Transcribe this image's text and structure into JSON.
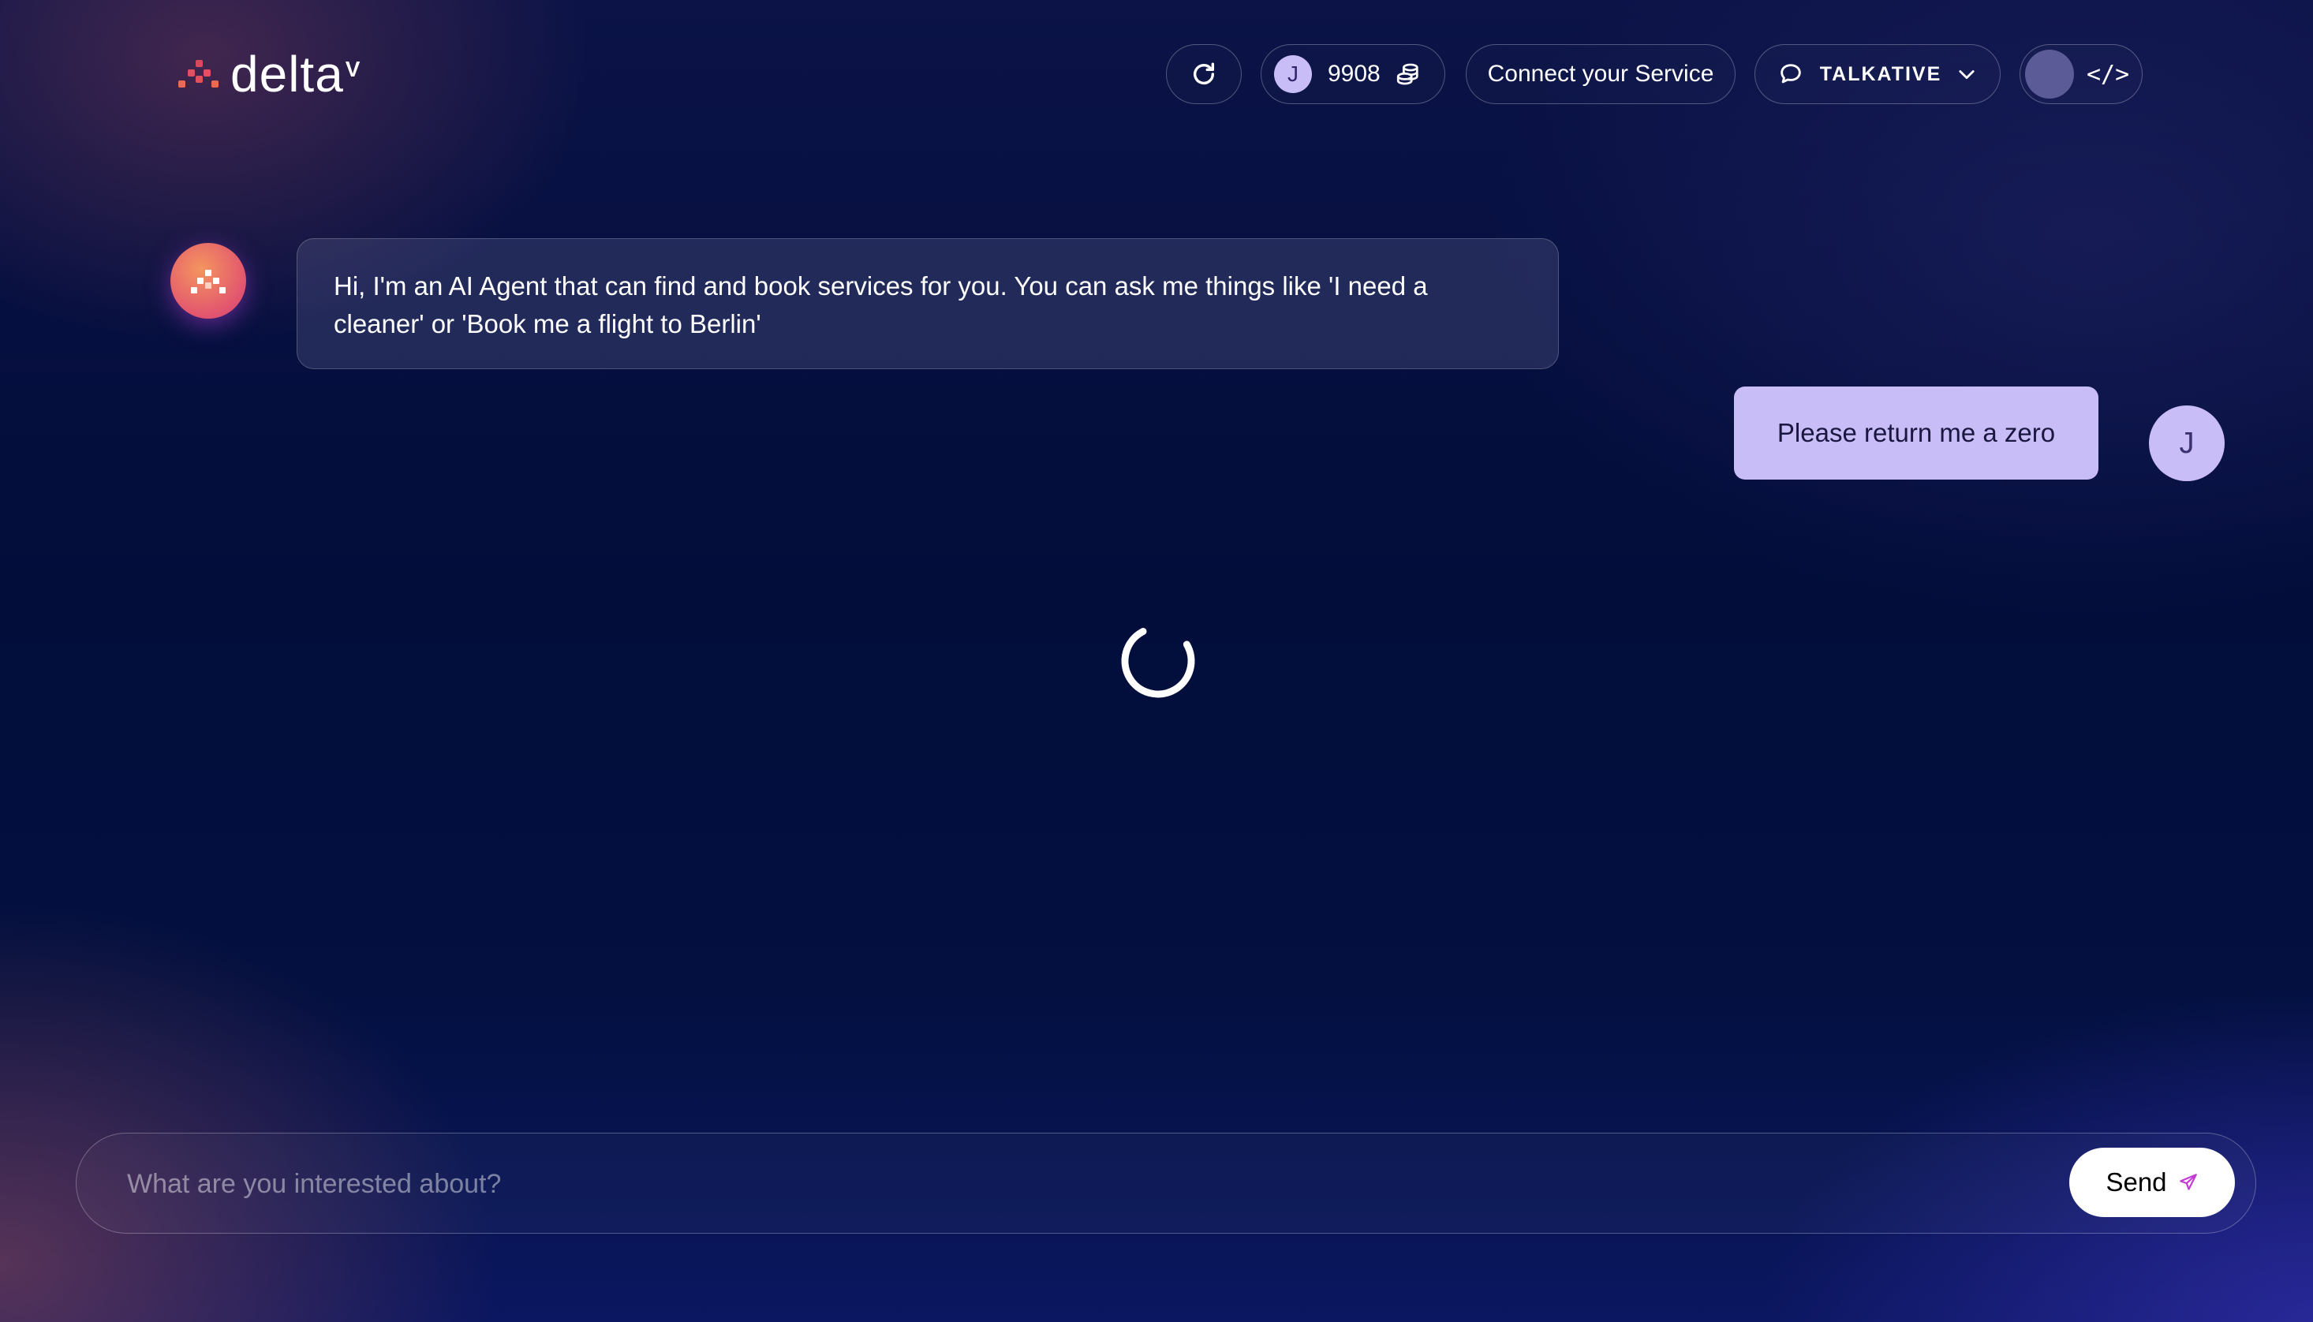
{
  "brand": {
    "name": "delta",
    "superscript": "V",
    "logo_icon": "delta-dots-logo"
  },
  "header": {
    "refresh_icon": "refresh-icon",
    "user_initial": "J",
    "credits": "9908",
    "credits_icon": "coins-icon",
    "connect_label": "Connect your Service",
    "mode_icon": "chat-bubble-icon",
    "mode_label": "TALKATIVE",
    "mode_chevron": "chevron-down-icon",
    "dev_icon": "code-icon",
    "dev_label": "</>"
  },
  "messages": [
    {
      "role": "agent",
      "text": "Hi, I'm an AI Agent that can find and book services for you. You can ask me things like 'I need a cleaner' or 'Book me a flight to Berlin'"
    },
    {
      "role": "user",
      "text": "Please return me a zero",
      "avatar": "J"
    }
  ],
  "composer": {
    "placeholder": "What are you interested about?",
    "value": "",
    "send_label": "Send",
    "send_icon": "paper-plane-icon"
  },
  "colors": {
    "accent": "#c9bdf7",
    "background": "#020d3a",
    "brand_dot": "#e0505e"
  }
}
